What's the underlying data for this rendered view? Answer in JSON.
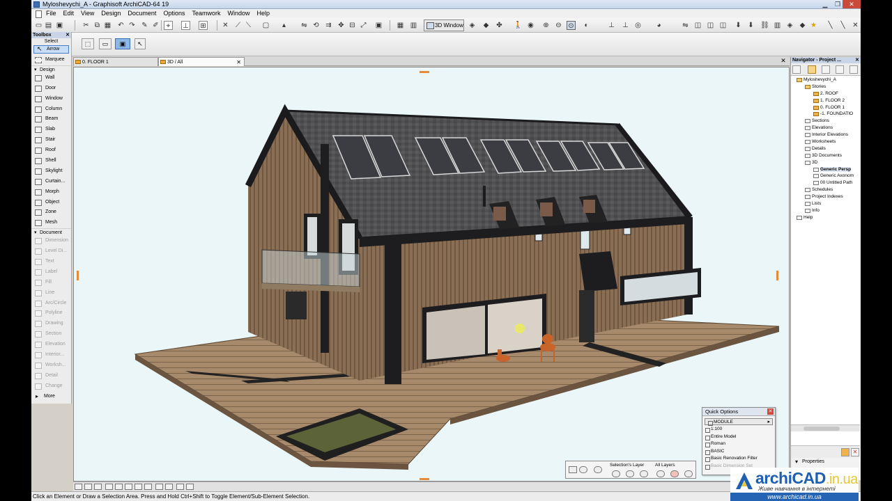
{
  "window": {
    "title": "Myloshevychi_A - Graphisoft ArchiCAD-64 19",
    "menus": [
      "File",
      "Edit",
      "View",
      "Design",
      "Document",
      "Options",
      "Teamwork",
      "Window",
      "Help"
    ]
  },
  "toolbar": {
    "view_button_label": "3D Window"
  },
  "toolbox": {
    "title": "Toolbox",
    "select_label": "Select",
    "arrow_label": "Arrow",
    "marquee_label": "Marquee",
    "design_group": "Design",
    "design_tools": [
      "Wall",
      "Door",
      "Window",
      "Column",
      "Beam",
      "Slab",
      "Stair",
      "Roof",
      "Shell",
      "Skylight",
      "Curtain...",
      "Morph",
      "Object",
      "Zone",
      "Mesh"
    ],
    "document_group": "Document",
    "document_tools": [
      "Dimension",
      "Level Di...",
      "Text",
      "Label",
      "Fill",
      "Line",
      "Arc/Circle",
      "Polyline",
      "Drawing",
      "Section",
      "Elevation",
      "Interior...",
      "Worksh...",
      "Detail",
      "Change"
    ],
    "more_label": "More"
  },
  "tabs": [
    {
      "label": "0. FLOOR 1",
      "active": false
    },
    {
      "label": "3D / All",
      "active": true
    }
  ],
  "navigator": {
    "title": "Navigator - Project ...",
    "tree": [
      {
        "label": "Myloshevychi_A",
        "level": 0,
        "kind": "project"
      },
      {
        "label": "Stories",
        "level": 1,
        "kind": "folder"
      },
      {
        "label": "2. ROOF",
        "level": 2,
        "kind": "story"
      },
      {
        "label": "1. FLOOR 2",
        "level": 2,
        "kind": "story"
      },
      {
        "label": "0. FLOOR 1",
        "level": 2,
        "kind": "story"
      },
      {
        "label": "-1. FOUNDATIO",
        "level": 2,
        "kind": "story"
      },
      {
        "label": "Sections",
        "level": 1,
        "kind": "item"
      },
      {
        "label": "Elevations",
        "level": 1,
        "kind": "item"
      },
      {
        "label": "Interior Elevations",
        "level": 1,
        "kind": "item"
      },
      {
        "label": "Worksheets",
        "level": 1,
        "kind": "item"
      },
      {
        "label": "Details",
        "level": 1,
        "kind": "item"
      },
      {
        "label": "3D Documents",
        "level": 1,
        "kind": "item"
      },
      {
        "label": "3D",
        "level": 1,
        "kind": "item"
      },
      {
        "label": "Generic Persp",
        "level": 2,
        "kind": "view",
        "selected": true
      },
      {
        "label": "Generic Axonom",
        "level": 2,
        "kind": "view"
      },
      {
        "label": "00 Untitled Path",
        "level": 2,
        "kind": "view"
      },
      {
        "label": "Schedules",
        "level": 1,
        "kind": "item"
      },
      {
        "label": "Project Indexes",
        "level": 1,
        "kind": "item"
      },
      {
        "label": "Lists",
        "level": 1,
        "kind": "item"
      },
      {
        "label": "Info",
        "level": 1,
        "kind": "item"
      },
      {
        "label": "Help",
        "level": 0,
        "kind": "item"
      }
    ],
    "properties_label": "Properties"
  },
  "quick_options": {
    "title": "Quick Options",
    "rows": [
      {
        "label": "MODULE",
        "kind": "header"
      },
      {
        "label": "1:100",
        "kind": "row"
      },
      {
        "label": "Entire Model",
        "kind": "row"
      },
      {
        "label": "Roman",
        "kind": "row"
      },
      {
        "label": "BASIC",
        "kind": "row"
      },
      {
        "label": "Basic Renovation Filter",
        "kind": "row"
      },
      {
        "label": "Basic Dimension Set",
        "kind": "dim"
      }
    ]
  },
  "layer_bar": {
    "selection_label": "Selection's Layer",
    "all_label": "All Layers"
  },
  "status_bar": {
    "text": "Click an Element or Draw a Selection Area. Press and Hold Ctrl+Shift to Toggle Element/Sub-Element Selection."
  },
  "watermark": {
    "brand": "archiCAD",
    "domain": ".in.ua",
    "tagline": "Живе навчання в інтернеті",
    "url": "www.archicad.in.ua"
  },
  "colors": {
    "viewport_bg": "#eaf6f7",
    "roof": "#4e4d50",
    "cladding": "#8e7358",
    "deck": "#a5896a",
    "trim": "#1d1d1f",
    "accent_blue": "#1f5fb0"
  }
}
